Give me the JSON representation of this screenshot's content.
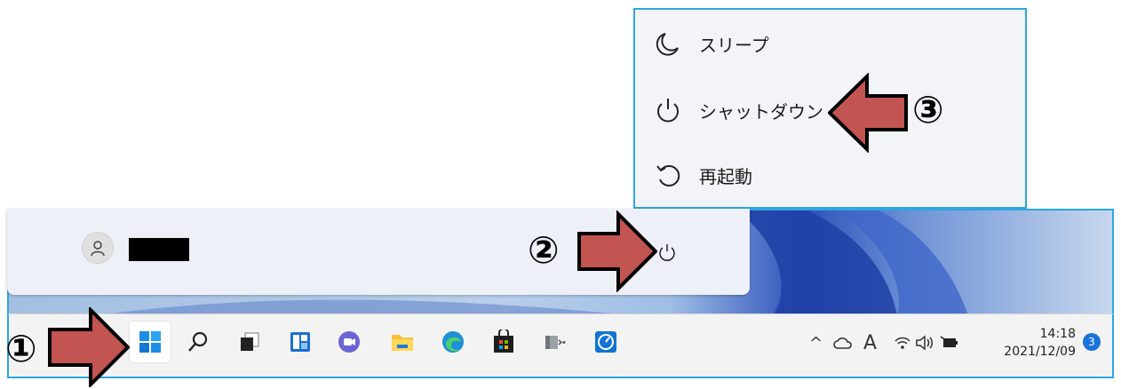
{
  "power_menu": {
    "items": [
      {
        "label": "スリープ",
        "icon": "moon-icon"
      },
      {
        "label": "シャットダウン",
        "icon": "power-icon"
      },
      {
        "label": "再起動",
        "icon": "restart-icon"
      }
    ]
  },
  "start_menu": {
    "user_avatar_icon": "person-icon",
    "power_icon": "power-icon"
  },
  "taskbar": {
    "apps": [
      "start-windows-icon",
      "search-icon",
      "task-view-icon",
      "widgets-icon",
      "teams-chat-icon",
      "file-explorer-icon",
      "edge-icon",
      "store-icon",
      "app-icon",
      "speedometer-icon"
    ],
    "tray": {
      "chevron": "^",
      "ime": "A",
      "time": "14:18",
      "date": "2021/12/09",
      "notification_count": "3"
    }
  },
  "annotations": {
    "step1": "①",
    "step2": "②",
    "step3": "③"
  },
  "colors": {
    "arrow_fill": "#c25451",
    "highlight_border": "#2ea6df",
    "accent": "#1a73d9"
  }
}
